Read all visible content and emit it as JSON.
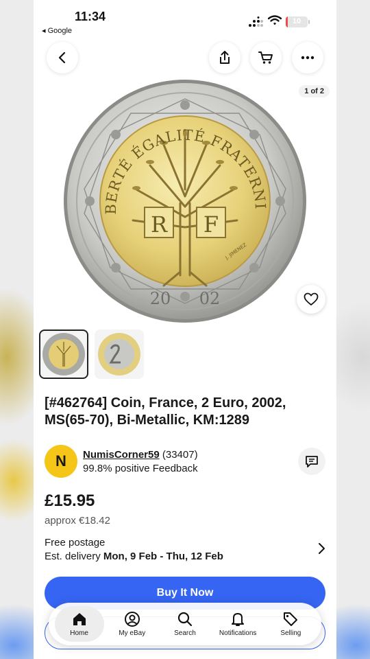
{
  "status": {
    "time": "11:34",
    "back_app": "◂ Google",
    "battery": "10",
    "battery_level": 0.1
  },
  "image": {
    "counter": "1 of 2"
  },
  "coin": {
    "inscription": "LIBERTÉ ÉGALITÉ FRATERNITÉ",
    "left_letter": "R",
    "right_letter": "F",
    "year_left": "20",
    "year_right": "02",
    "engraver": "J. JIMENEZ"
  },
  "listing": {
    "title": "[#462764] Coin, France, 2 Euro, 2002, MS(65-70), Bi-Metallic, KM:1289",
    "seller_initial": "N",
    "seller_name": "NumisCorner59",
    "seller_count": "(33407)",
    "seller_feedback": "99.8% positive Feedback",
    "price": "£15.95",
    "approx": "approx €18.42",
    "postage": "Free postage",
    "delivery_prefix": "Est. delivery ",
    "delivery_dates": "Mon, 9 Feb - Thu, 12 Feb",
    "buy_label": "Buy It Now"
  },
  "tabs": [
    {
      "label": "Home",
      "icon": "home-icon"
    },
    {
      "label": "My eBay",
      "icon": "profile-icon"
    },
    {
      "label": "Search",
      "icon": "search-icon"
    },
    {
      "label": "Notifications",
      "icon": "bell-icon"
    },
    {
      "label": "Selling",
      "icon": "tag-icon"
    }
  ],
  "colors": {
    "brand_blue": "#3665f3",
    "avatar_yellow": "#f5c518",
    "battery_red": "#ee4b4b"
  }
}
